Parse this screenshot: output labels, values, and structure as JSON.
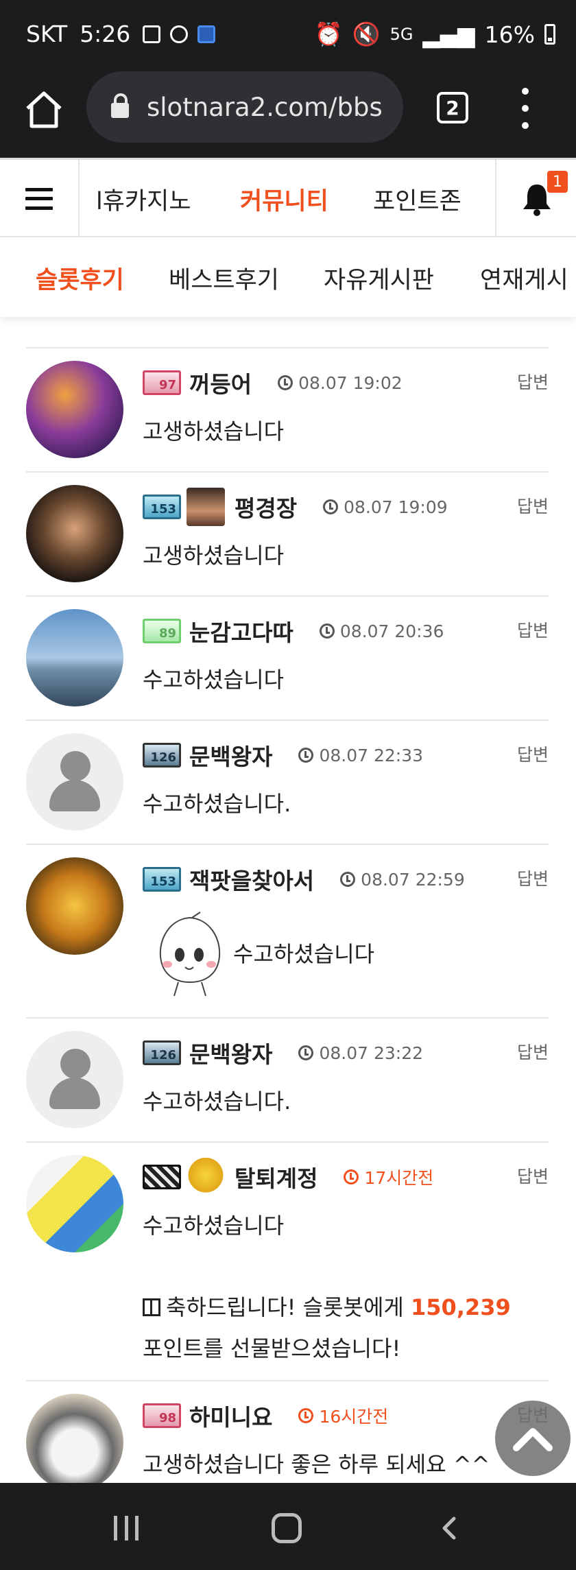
{
  "status_bar": {
    "carrier": "SKT",
    "time": "5:26",
    "network": "5G",
    "battery": "16%"
  },
  "browser": {
    "url": "slotnara2.com/bbs",
    "tab_count": "2"
  },
  "site_nav": {
    "items": [
      "l휴카지노",
      "커뮤니티",
      "포인트존"
    ],
    "active": "커뮤니티",
    "notification_count": "1"
  },
  "sub_nav": {
    "items": [
      "슬롯후기",
      "베스트후기",
      "자유게시판",
      "연재게시"
    ],
    "active": "슬롯후기"
  },
  "comments": [
    {
      "level": "97",
      "nickname": "꺼등어",
      "time": "08.07 19:02",
      "text": "고생하셨습니다",
      "reply": "답변"
    },
    {
      "level": "153",
      "nickname": "평경장",
      "time": "08.07 19:09",
      "text": "고생하셨습니다",
      "reply": "답변"
    },
    {
      "level": "89",
      "nickname": "눈감고다따",
      "time": "08.07 20:36",
      "text": "수고하셨습니다",
      "reply": "답변"
    },
    {
      "level": "126",
      "nickname": "문백왕자",
      "time": "08.07 22:33",
      "text": "수고하셨습니다.",
      "reply": "답변"
    },
    {
      "level": "153",
      "nickname": "잭팟을찾아서",
      "time": "08.07 22:59",
      "text": "수고하셨습니다",
      "reply": "답변"
    },
    {
      "level": "126",
      "nickname": "문백왕자",
      "time": "08.07 23:22",
      "text": "수고하셨습니다.",
      "reply": "답변"
    },
    {
      "level": "",
      "nickname": "탈퇴계정",
      "time": "17시간전",
      "text": "수고하셨습니다",
      "reply": "답변",
      "gift": {
        "prefix": "축하드립니다! 슬롯봇에게",
        "points": "150,239",
        "suffix": "포인트를 선물받으셨습니다!"
      }
    },
    {
      "level": "98",
      "nickname": "하미니요",
      "time": "16시간전",
      "text": "고생하셨습니다 좋은 하루 되세요 ^^",
      "reply": "답변"
    }
  ],
  "colors": {
    "accent": "#f0501e",
    "dark_bar": "#1b1c1e",
    "divider": "#e6e6e6"
  }
}
